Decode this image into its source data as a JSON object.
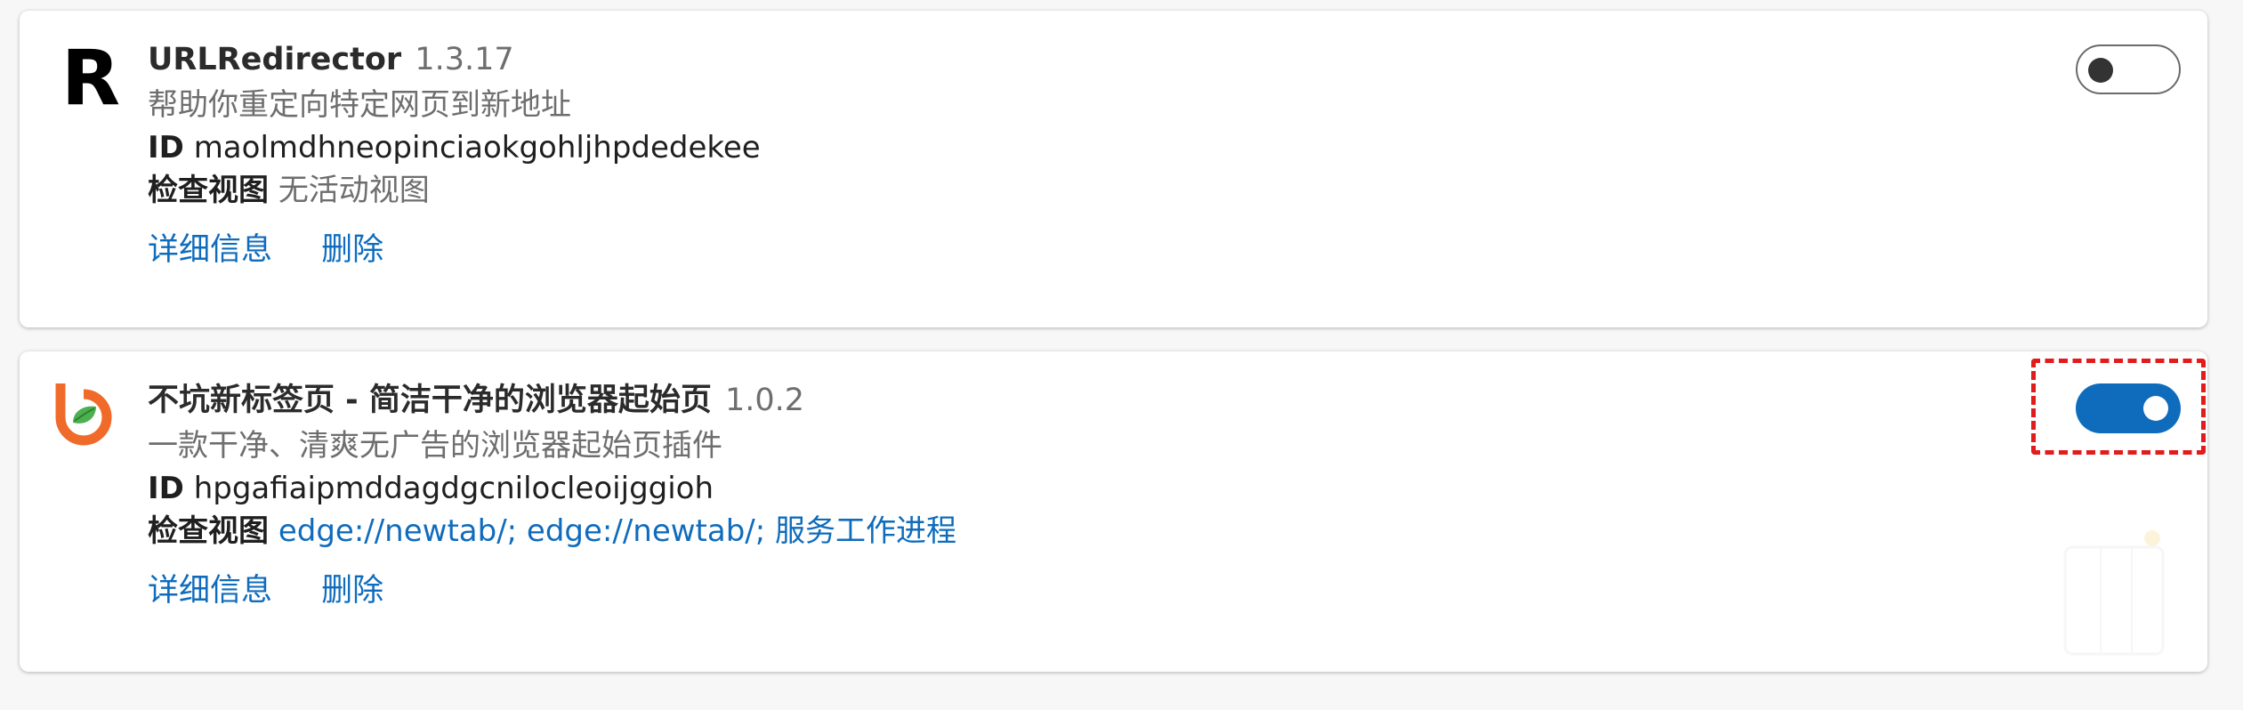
{
  "extensions": [
    {
      "icon": "letter-r-icon",
      "icon_letter": "R",
      "name": "URLRedirector",
      "version": "1.3.17",
      "description": "帮助你重定向特定网页到新地址",
      "id_label": "ID",
      "id_value": "maolmdhneopinciaokgohljhpdedekee",
      "inspect_label": "检查视图",
      "inspect_value": "无活动视图",
      "details_label": "详细信息",
      "remove_label": "删除",
      "enabled": false
    },
    {
      "icon": "bukeng-logo-icon",
      "name": "不坑新标签页 - 简洁干净的浏览器起始页",
      "version": "1.0.2",
      "description": "一款干净、清爽无广告的浏览器起始页插件",
      "id_label": "ID",
      "id_value": "hpgafiaipmddagdgcnilocleoijggioh",
      "inspect_label": "检查视图",
      "inspect_links": "edge://newtab/; edge://newtab/; 服务工作进程",
      "details_label": "详细信息",
      "remove_label": "删除",
      "enabled": true
    }
  ],
  "colors": {
    "accent": "#0f6cbd",
    "highlight": "#e21b1b",
    "logo_orange": "#f06a2a",
    "logo_green": "#4caf50"
  }
}
